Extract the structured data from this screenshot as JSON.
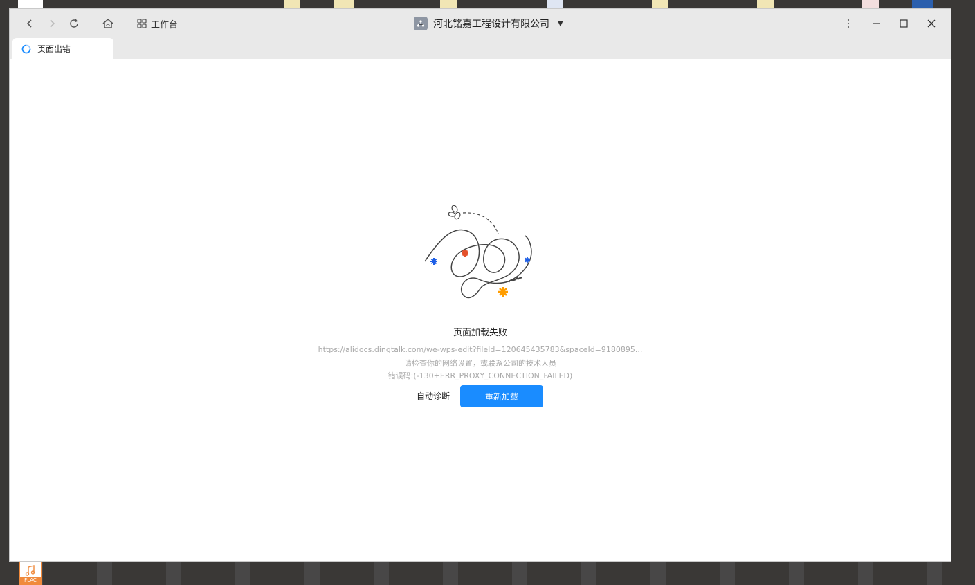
{
  "header": {
    "workbench_label": "工作台",
    "org_name": "河北铭嘉工程设计有限公司"
  },
  "tab": {
    "title": "页面出错"
  },
  "error": {
    "title": "页面加载失败",
    "url": "https://alidocs.dingtalk.com/we-wps-edit?fileId=120645435783&spaceId=9180895...",
    "hint": "请检查你的网络设置，或联系公司的技术人员",
    "code": "错误码:(-130+ERR_PROXY_CONNECTION_FAILED)",
    "diagnose_label": "自动诊断",
    "reload_label": "重新加载"
  },
  "desktop": {
    "flac_label": "FLAC"
  },
  "colors": {
    "accent": "#1a8cff",
    "star_blue": "#1d5ee6",
    "star_red": "#e4502a",
    "star_orange": "#ff9d00"
  }
}
